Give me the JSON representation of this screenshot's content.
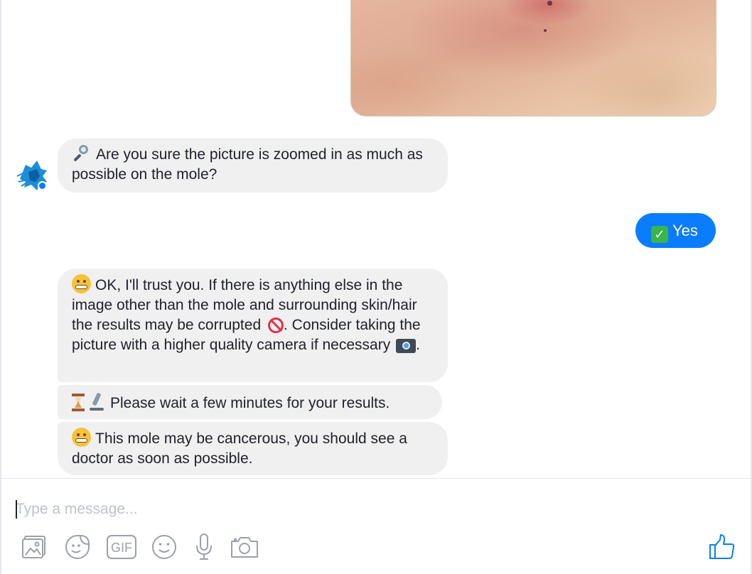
{
  "conversation": {
    "messages": [
      {
        "sender": "bot",
        "text": "Are you sure the picture is zoomed in as much as possible on the mole?"
      },
      {
        "sender": "user",
        "text": "Yes"
      },
      {
        "sender": "bot",
        "text_parts": [
          "OK, I'll trust you. If there is anything else in the image other than the mole and surrounding skin/hair the results may be corrupted",
          ". Consider taking the picture with a higher quality camera if necessary",
          "."
        ]
      },
      {
        "sender": "bot",
        "text": "Please wait a few minutes for your results."
      },
      {
        "sender": "bot",
        "text": "This mole may be cancerous, you should see a doctor as soon as possible."
      }
    ]
  },
  "composer": {
    "placeholder": "Type a message..."
  },
  "toolbar": {
    "icons": [
      "photo-icon",
      "sticker-icon",
      "gif-icon",
      "emoji-icon",
      "microphone-icon",
      "camera-icon"
    ],
    "gif_label": "GIF"
  },
  "colors": {
    "user_bubble": "#0a7cff",
    "bot_bubble": "#f1f0f0",
    "accent": "#0a7cff"
  }
}
